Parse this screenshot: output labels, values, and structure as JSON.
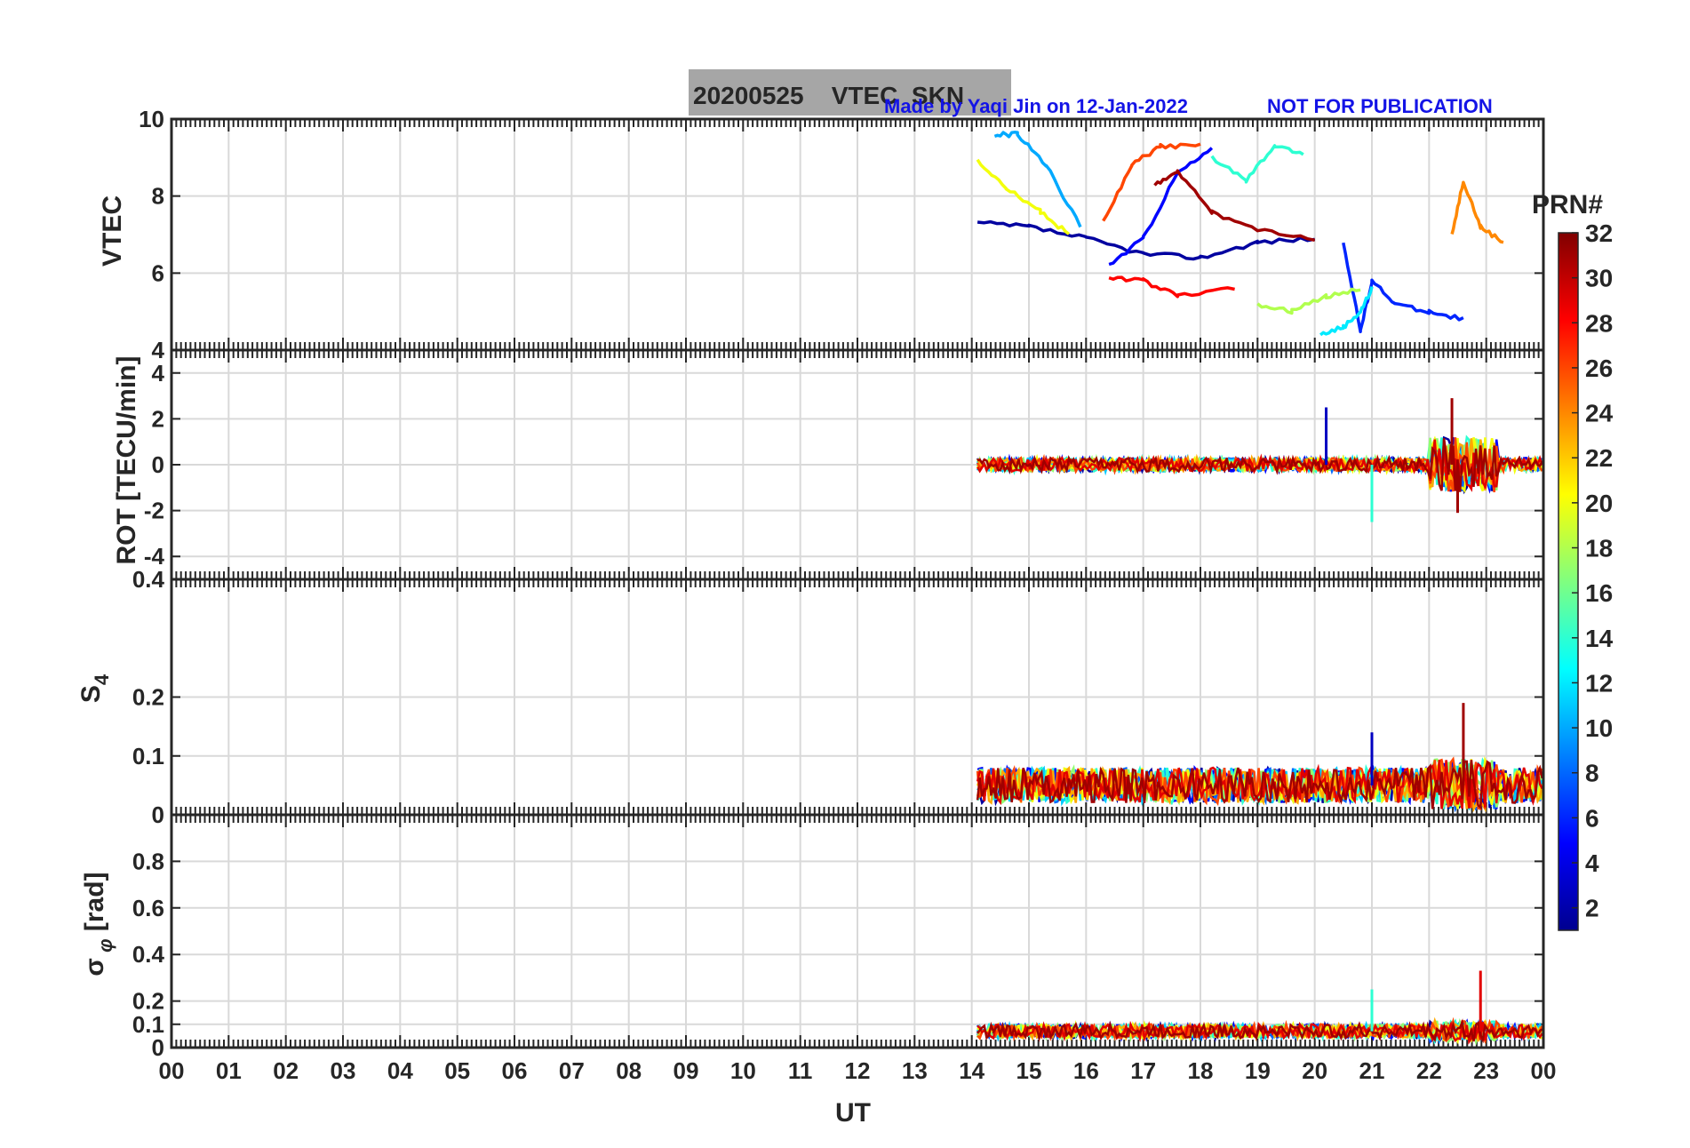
{
  "title_box": {
    "text": "20200525    VTEC  SKN"
  },
  "credit": {
    "made_by": "Made by Yaqi Jin on 12-Jan-2022",
    "notice": "NOT FOR PUBLICATION"
  },
  "colors": {
    "title_box_bg": "#a6a6a6",
    "credit_text": "#1414e6",
    "axis": "#262626",
    "grid": "#d9d9d9"
  },
  "colorbar": {
    "label": "PRN#",
    "ticks": [
      "2",
      "4",
      "6",
      "8",
      "10",
      "12",
      "14",
      "16",
      "18",
      "20",
      "22",
      "24",
      "26",
      "28",
      "30",
      "32"
    ],
    "range": [
      1,
      32
    ],
    "colormap": "jet"
  },
  "chart_data": [
    {
      "type": "line",
      "ylabel": "VTEC",
      "ylim": [
        4,
        10
      ],
      "yticks": [
        "4",
        "6",
        "8",
        "10"
      ],
      "xlim": [
        0,
        24
      ],
      "grid": true,
      "series_note": "one line per PRN 1-32 colored by colorbar",
      "series": [
        {
          "prn": 2,
          "x": [
            14.1,
            15,
            16,
            17,
            18,
            19,
            20
          ],
          "y": [
            7.3,
            7.2,
            6.9,
            6.5,
            6.4,
            6.8,
            6.9
          ]
        },
        {
          "prn": 5,
          "x": [
            16.4,
            17,
            17.6,
            18.2
          ],
          "y": [
            6.2,
            6.9,
            8.6,
            9.2
          ]
        },
        {
          "prn": 6,
          "x": [
            20.5,
            20.8,
            21,
            21.4,
            22,
            22.6
          ],
          "y": [
            6.8,
            4.5,
            5.8,
            5.2,
            5.0,
            4.8
          ]
        },
        {
          "prn": 10,
          "x": [
            14.4,
            14.8,
            15.3,
            15.9
          ],
          "y": [
            9.6,
            9.6,
            8.8,
            7.2
          ]
        },
        {
          "prn": 12,
          "x": [
            20.1,
            20.5,
            20.8,
            21
          ],
          "y": [
            4.4,
            4.6,
            5.0,
            5.6
          ]
        },
        {
          "prn": 14,
          "x": [
            18.2,
            18.8,
            19.3,
            19.8
          ],
          "y": [
            9.0,
            8.4,
            9.3,
            9.1
          ]
        },
        {
          "prn": 18,
          "x": [
            19,
            19.6,
            20.2,
            20.8
          ],
          "y": [
            5.2,
            5.0,
            5.4,
            5.6
          ]
        },
        {
          "prn": 20,
          "x": [
            14.1,
            14.6,
            15.2,
            15.7
          ],
          "y": [
            8.9,
            8.2,
            7.6,
            7.0
          ]
        },
        {
          "prn": 24,
          "x": [
            22.4,
            22.6,
            22.9,
            23.3
          ],
          "y": [
            7.0,
            8.4,
            7.2,
            6.8
          ]
        },
        {
          "prn": 26,
          "x": [
            16.3,
            16.8,
            17.3,
            18
          ],
          "y": [
            7.3,
            8.8,
            9.3,
            9.3
          ]
        },
        {
          "prn": 28,
          "x": [
            16.4,
            17,
            17.6,
            18.6
          ],
          "y": [
            5.9,
            5.8,
            5.4,
            5.6
          ]
        },
        {
          "prn": 31,
          "x": [
            17.2,
            17.6,
            18.2,
            19,
            20
          ],
          "y": [
            8.3,
            8.6,
            7.6,
            7.1,
            6.9
          ]
        }
      ]
    },
    {
      "type": "line",
      "ylabel": "ROT [TECU/min]",
      "ylim": [
        -5,
        5
      ],
      "yticks": [
        "-4",
        "-2",
        "0",
        "2",
        "4"
      ],
      "xlim": [
        0,
        24
      ],
      "grid": true,
      "notable": [
        {
          "x": 20.2,
          "y": 2.5,
          "prn": 3
        },
        {
          "x": 21.0,
          "y": -2.5,
          "prn": 14
        },
        {
          "x": 22.4,
          "y": 2.9,
          "prn": 31
        },
        {
          "x": 22.5,
          "y": -2.1,
          "prn": 31
        }
      ]
    },
    {
      "type": "line",
      "ylabel": "S4",
      "ylim": [
        0,
        0.4
      ],
      "yticks": [
        "0",
        "0.1",
        "0.2",
        "0.4"
      ],
      "xlim": [
        0,
        24
      ],
      "grid": true,
      "notable": [
        {
          "x": 21.0,
          "y": 0.14,
          "prn": 3
        },
        {
          "x": 22.6,
          "y": 0.19,
          "prn": 31
        }
      ]
    },
    {
      "type": "line",
      "ylabel": "σ φ [rad]",
      "ylim": [
        0,
        1
      ],
      "yticks": [
        "0",
        "0.1",
        "0.2",
        "0.4",
        "0.6",
        "0.8"
      ],
      "xlim": [
        0,
        24
      ],
      "xlabel": "UT",
      "xticks": [
        "00",
        "01",
        "02",
        "03",
        "04",
        "05",
        "06",
        "07",
        "08",
        "09",
        "10",
        "11",
        "12",
        "13",
        "14",
        "15",
        "16",
        "17",
        "18",
        "19",
        "20",
        "21",
        "22",
        "23",
        "00"
      ],
      "grid": true,
      "notable": [
        {
          "x": 21.0,
          "y": 0.25,
          "prn": 14
        },
        {
          "x": 22.9,
          "y": 0.33,
          "prn": 29
        }
      ]
    }
  ]
}
